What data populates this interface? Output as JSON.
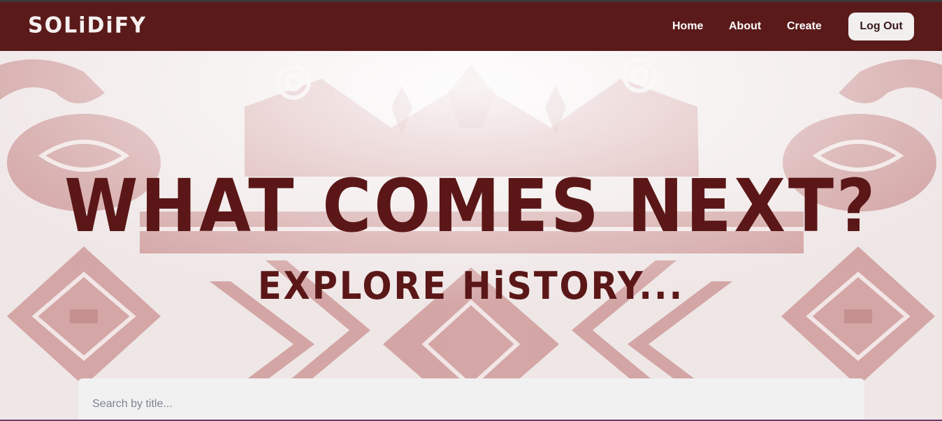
{
  "brand": {
    "logo_text": "SOLiDiFY"
  },
  "nav": {
    "home_label": "Home",
    "about_label": "About",
    "create_label": "Create",
    "logout_label": "Log Out"
  },
  "hero": {
    "headline": "WHAT COMES NEXT?",
    "subheadline": "EXPLORE HiSTORY..."
  },
  "search": {
    "placeholder": "Search by title...",
    "value": ""
  },
  "colors": {
    "navbar": "#5a1a1a",
    "accent_text": "#5b1717",
    "pattern": "#c98f8f",
    "logout_bg": "#f2efef"
  }
}
